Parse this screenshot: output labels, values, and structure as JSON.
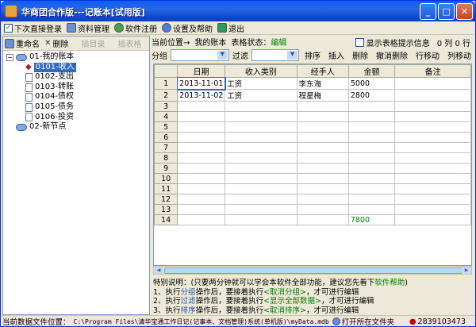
{
  "window": {
    "title": "华商团合作版---记账本[试用版]"
  },
  "toolbar": {
    "direct_login": "下次直接登录",
    "data_manage": "资料管理",
    "register": "软件注册",
    "settings_help": "设置及帮助",
    "exit": "退出"
  },
  "left_toolbar": {
    "rename": "重命名",
    "delete": "删除",
    "insert_dir": "插目录",
    "insert_table": "插表格"
  },
  "tree": [
    {
      "label": "01-我的账本",
      "children": [
        "0101-收入",
        "0102-支出",
        "0103-转账",
        "0104-债权",
        "0105-债务",
        "0106-投资"
      ]
    },
    {
      "label": "02-新节点",
      "children": []
    }
  ],
  "right_header": {
    "location_label": "当前位置→",
    "location": "我的账本",
    "status_label": "表格状态：",
    "status_value": "编辑",
    "tip_label": "显示表格提示信息",
    "cell_pos": "0 列 0 行"
  },
  "filter_bar": {
    "group_label": "分组",
    "filter_label": "过滤",
    "sort": "排序",
    "insert": "插入",
    "delete": "删除",
    "undo_delete": "撤消删除",
    "row_move": "行移动",
    "col_move": "列移动"
  },
  "grid": {
    "columns": [
      "日期",
      "收入类别",
      "经手人",
      "金额",
      "备注"
    ],
    "rows": [
      [
        "1",
        "2013-11-01",
        "工资",
        "李东海",
        "5000",
        ""
      ],
      [
        "2",
        "2013-11-02",
        "工资",
        "程星梅",
        "2800",
        ""
      ],
      [
        "3",
        "",
        "",
        "",
        "",
        ""
      ],
      [
        "4",
        "",
        "",
        "",
        "",
        ""
      ],
      [
        "5",
        "",
        "",
        "",
        "",
        ""
      ],
      [
        "6",
        "",
        "",
        "",
        "",
        ""
      ],
      [
        "7",
        "",
        "",
        "",
        "",
        ""
      ],
      [
        "8",
        "",
        "",
        "",
        "",
        ""
      ],
      [
        "9",
        "",
        "",
        "",
        "",
        ""
      ],
      [
        "10",
        "",
        "",
        "",
        "",
        ""
      ],
      [
        "11",
        "",
        "",
        "",
        "",
        ""
      ],
      [
        "12",
        "",
        "",
        "",
        "",
        ""
      ],
      [
        "13",
        "",
        "",
        "",
        "",
        ""
      ],
      [
        "14",
        "",
        "",
        "",
        "7800",
        ""
      ]
    ]
  },
  "notes": {
    "line0_pre": "特别说明：(只要两分钟就可以学会本软件全部功能，建议您先看下",
    "line0_link": "软件帮助",
    "line0_post": ")",
    "line1_pre": "1、执行",
    "line1_op": "分组",
    "line1_mid": "操作后，要接着执行",
    "line1_cmd": "<取消分组>",
    "line1_post": "，才可进行编辑",
    "line2_pre": "2、执行",
    "line2_op": "过滤",
    "line2_mid": "操作后，要接着执行",
    "line2_cmd": "<显示全部数据>",
    "line2_post": "，才可进行编辑",
    "line3_pre": "3、执行",
    "line3_op": "排序",
    "line3_mid": "操作后，要接着执行",
    "line3_cmd": "<取消排序>",
    "line3_post": "，才可进行编辑"
  },
  "statusbar": {
    "label": "当前数据文件位置：",
    "path": "C:\\Program Files\\清华宝通工作日记(记事本、文档管理)系统(单机版)\\myData.mdb",
    "open_folder": "打开所在文件夹",
    "qq": "2839103473"
  }
}
